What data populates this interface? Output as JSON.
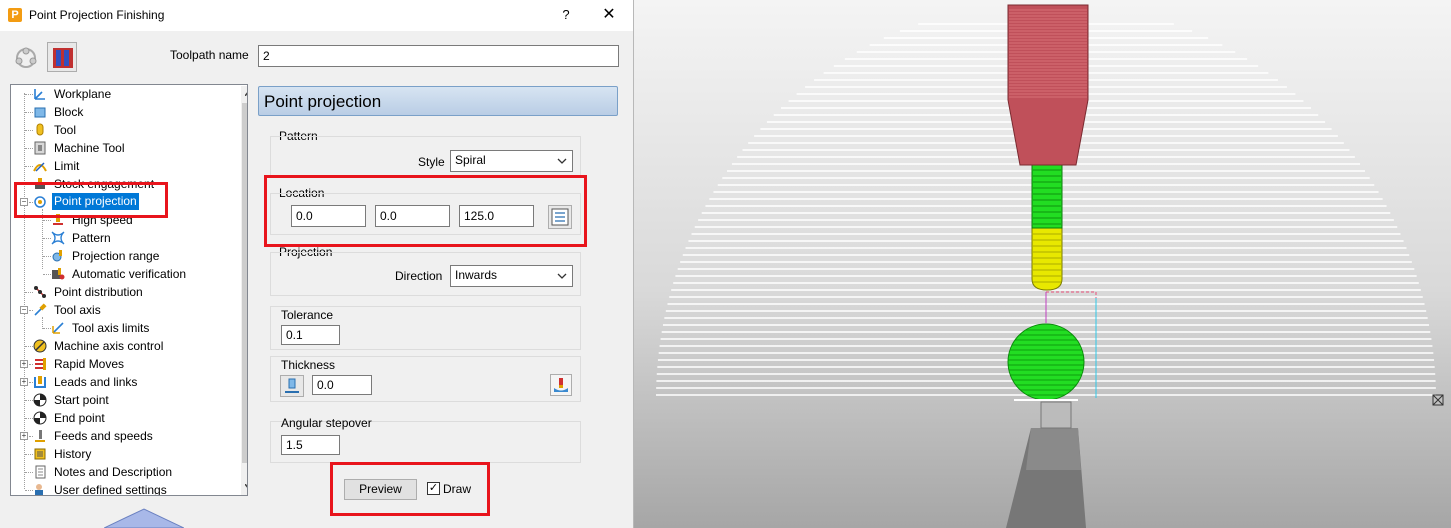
{
  "window": {
    "title": "Point Projection Finishing",
    "app_icon_letter": "P",
    "help_label": "?",
    "close_label": "✕"
  },
  "form": {
    "toolpath_name_label": "Toolpath name",
    "toolpath_name_value": "2"
  },
  "tree": {
    "items": [
      {
        "label": "Workplane"
      },
      {
        "label": "Block"
      },
      {
        "label": "Tool"
      },
      {
        "label": "Machine Tool"
      },
      {
        "label": "Limit"
      },
      {
        "label": "Stock engagement"
      },
      {
        "label": "Point projection"
      },
      {
        "label": "High speed"
      },
      {
        "label": "Pattern"
      },
      {
        "label": "Projection range"
      },
      {
        "label": "Automatic verification"
      },
      {
        "label": "Point distribution"
      },
      {
        "label": "Tool axis"
      },
      {
        "label": "Tool axis limits"
      },
      {
        "label": "Machine axis control"
      },
      {
        "label": "Rapid Moves"
      },
      {
        "label": "Leads and links"
      },
      {
        "label": "Start point"
      },
      {
        "label": "End point"
      },
      {
        "label": "Feeds and speeds"
      },
      {
        "label": "History"
      },
      {
        "label": "Notes and Description"
      },
      {
        "label": "User defined settings"
      }
    ],
    "expander_plus": "+",
    "expander_minus": "−"
  },
  "panel": {
    "title": "Point projection",
    "pattern": {
      "label": "Pattern",
      "style_label": "Style",
      "style_value": "Spiral"
    },
    "location": {
      "label": "Location",
      "x": "0.0",
      "y": "0.0",
      "z": "125.0"
    },
    "projection": {
      "label": "Projection",
      "direction_label": "Direction",
      "direction_value": "Inwards"
    },
    "tolerance": {
      "label": "Tolerance",
      "value": "0.1"
    },
    "thickness": {
      "label": "Thickness",
      "value": "0.0"
    },
    "angular_stepover": {
      "label": "Angular stepover",
      "value": "1.5"
    },
    "preview_label": "Preview",
    "draw_label": "Draw",
    "draw_checked": "✓"
  },
  "colors": {
    "highlight": "#e8141c",
    "selection": "#0078d7",
    "header": "#b9cde5",
    "holder": "#c0505a",
    "shank": "#e8e800",
    "flute": "#22dd22"
  }
}
